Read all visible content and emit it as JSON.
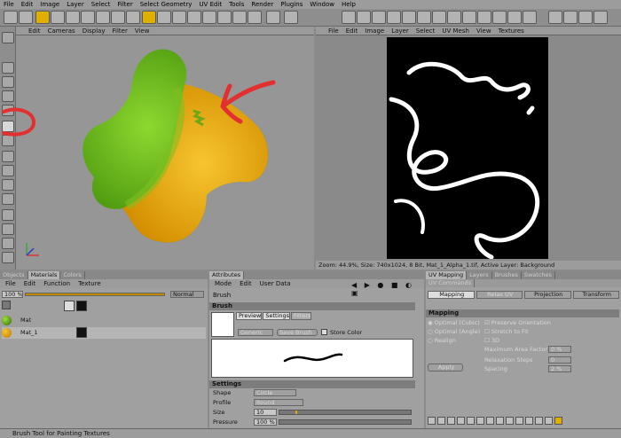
{
  "menu": [
    "File",
    "Edit",
    "Image",
    "Layer",
    "Select",
    "Filter",
    "Select Geometry",
    "UV Edit",
    "Tools",
    "Render",
    "Plugins",
    "Window",
    "Help"
  ],
  "viewport": {
    "menu": [
      "Edit",
      "Cameras",
      "Display",
      "Filter",
      "View"
    ]
  },
  "uv_editor": {
    "menu": [
      "File",
      "Edit",
      "Image",
      "Layer",
      "Select",
      "UV Mesh",
      "View",
      "Textures"
    ],
    "status": "Zoom: 44.9%, Size: 740x1024, 8 Bit, Mat_1_Alpha_1.tif, Active Layer: Background"
  },
  "materials_panel": {
    "tabs": [
      "Objects",
      "Materials",
      "Colors"
    ],
    "menu": [
      "File",
      "Edit",
      "Function",
      "Texture"
    ],
    "zoom": "100 %",
    "mode": "Normal",
    "items": [
      {
        "label": "Mat"
      },
      {
        "label": "Mat_1"
      }
    ]
  },
  "attributes_panel": {
    "tab": "Attributes",
    "menu": [
      "Mode",
      "Edit",
      "User Data"
    ],
    "title": "Brush",
    "section": "Brush",
    "subtabs": [
      "Preview",
      "Settings",
      "Filters"
    ],
    "preset": "Generic",
    "save_brush": "Save Brush",
    "store_color": "Store Color",
    "settings_title": "Settings",
    "rows": [
      {
        "label": "Shape",
        "value": "Circle"
      },
      {
        "label": "Profile",
        "value": "Round"
      },
      {
        "label": "Size",
        "value": "10"
      },
      {
        "label": "Pressure",
        "value": "100 %"
      }
    ]
  },
  "uv_panel": {
    "tabs": [
      "UV Mapping",
      "Layers",
      "Brushes",
      "Swatches"
    ],
    "commands_tab": "UV Commands",
    "subtabs": [
      "Mapping",
      "Relax UV",
      "Projection",
      "Transform"
    ],
    "section": "Mapping",
    "options": [
      "Optimal (Cubic)",
      "Optimal (Angle)",
      "Realign"
    ],
    "checks": [
      "Preserve Orientation",
      "Stretch to Fit",
      "3D"
    ],
    "params": [
      {
        "label": "Maximum Area Factor",
        "value": "0 %"
      },
      {
        "label": "Relaxation Steps",
        "value": "0"
      },
      {
        "label": "Spacing",
        "value": "2 %"
      }
    ],
    "apply": "Apply"
  },
  "status": "Brush Tool for Painting Textures"
}
